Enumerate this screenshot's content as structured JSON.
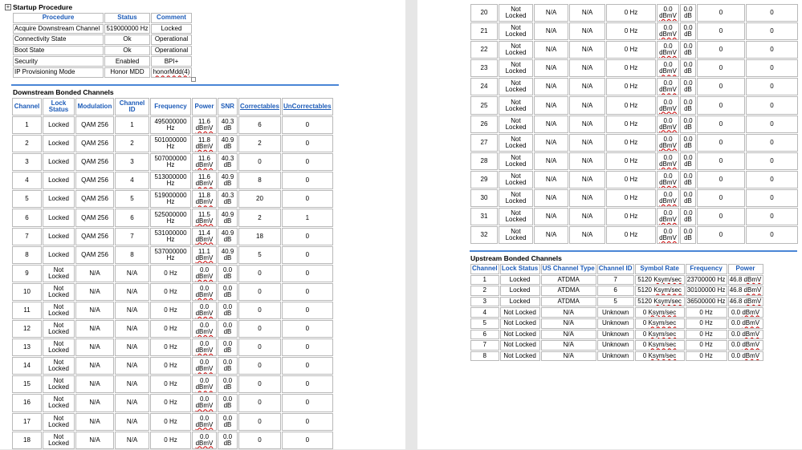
{
  "startup": {
    "toggle_glyph": "+",
    "title": "Startup Procedure",
    "headers": [
      "Procedure",
      "Status",
      "Comment"
    ],
    "rows": [
      {
        "procedure": "Acquire Downstream Channel",
        "status": "519000000 Hz",
        "comment": "Locked"
      },
      {
        "procedure": "Connectivity State",
        "status": "Ok",
        "comment": "Operational"
      },
      {
        "procedure": "Boot State",
        "status": "Ok",
        "comment": "Operational"
      },
      {
        "procedure": "Security",
        "status": "Enabled",
        "comment": "BPI+"
      },
      {
        "procedure": "IP Provisioning Mode",
        "status": "Honor MDD",
        "comment": "honorMdd(4)"
      }
    ]
  },
  "downstream": {
    "title": "Downstream Bonded Channels",
    "headers": [
      "Channel",
      "Lock Status",
      "Modulation",
      "Channel ID",
      "Frequency",
      "Power",
      "SNR",
      "Correctables",
      "UnCorrectables"
    ],
    "rows": [
      {
        "channel": "1",
        "lock": "Locked",
        "mod": "QAM 256",
        "id": "1",
        "freq": "495000000 Hz",
        "power": "11.6",
        "unit": "dBmV",
        "snr": "40.3 dB",
        "corr": "6",
        "uncorr": "0"
      },
      {
        "channel": "2",
        "lock": "Locked",
        "mod": "QAM 256",
        "id": "2",
        "freq": "501000000 Hz",
        "power": "11.8",
        "unit": "dBmV",
        "snr": "40.9 dB",
        "corr": "2",
        "uncorr": "0"
      },
      {
        "channel": "3",
        "lock": "Locked",
        "mod": "QAM 256",
        "id": "3",
        "freq": "507000000 Hz",
        "power": "11.6",
        "unit": "dBmV",
        "snr": "40.3 dB",
        "corr": "0",
        "uncorr": "0"
      },
      {
        "channel": "4",
        "lock": "Locked",
        "mod": "QAM 256",
        "id": "4",
        "freq": "513000000 Hz",
        "power": "11.6",
        "unit": "dBmV",
        "snr": "40.9 dB",
        "corr": "8",
        "uncorr": "0"
      },
      {
        "channel": "5",
        "lock": "Locked",
        "mod": "QAM 256",
        "id": "5",
        "freq": "519000000 Hz",
        "power": "11.8",
        "unit": "dBmV",
        "snr": "40.3 dB",
        "corr": "20",
        "uncorr": "0"
      },
      {
        "channel": "6",
        "lock": "Locked",
        "mod": "QAM 256",
        "id": "6",
        "freq": "525000000 Hz",
        "power": "11.5",
        "unit": "dBmV",
        "snr": "40.9 dB",
        "corr": "2",
        "uncorr": "1"
      },
      {
        "channel": "7",
        "lock": "Locked",
        "mod": "QAM 256",
        "id": "7",
        "freq": "531000000 Hz",
        "power": "11.4",
        "unit": "dBmV",
        "snr": "40.9 dB",
        "corr": "18",
        "uncorr": "0"
      },
      {
        "channel": "8",
        "lock": "Locked",
        "mod": "QAM 256",
        "id": "8",
        "freq": "537000000 Hz",
        "power": "11.1",
        "unit": "dBmV",
        "snr": "40.9 dB",
        "corr": "5",
        "uncorr": "0"
      },
      {
        "channel": "9",
        "lock": "Not Locked",
        "mod": "N/A",
        "id": "N/A",
        "freq": "0 Hz",
        "power": "0.0",
        "unit": "dBmV",
        "snr": "0.0 dB",
        "corr": "0",
        "uncorr": "0"
      },
      {
        "channel": "10",
        "lock": "Not Locked",
        "mod": "N/A",
        "id": "N/A",
        "freq": "0 Hz",
        "power": "0.0",
        "unit": "dBmV",
        "snr": "0.0 dB",
        "corr": "0",
        "uncorr": "0"
      },
      {
        "channel": "11",
        "lock": "Not Locked",
        "mod": "N/A",
        "id": "N/A",
        "freq": "0 Hz",
        "power": "0.0",
        "unit": "dBmV",
        "snr": "0.0 dB",
        "corr": "0",
        "uncorr": "0"
      },
      {
        "channel": "12",
        "lock": "Not Locked",
        "mod": "N/A",
        "id": "N/A",
        "freq": "0 Hz",
        "power": "0.0",
        "unit": "dBmV",
        "snr": "0.0 dB",
        "corr": "0",
        "uncorr": "0"
      },
      {
        "channel": "13",
        "lock": "Not Locked",
        "mod": "N/A",
        "id": "N/A",
        "freq": "0 Hz",
        "power": "0.0",
        "unit": "dBmV",
        "snr": "0.0 dB",
        "corr": "0",
        "uncorr": "0"
      },
      {
        "channel": "14",
        "lock": "Not Locked",
        "mod": "N/A",
        "id": "N/A",
        "freq": "0 Hz",
        "power": "0.0",
        "unit": "dBmV",
        "snr": "0.0 dB",
        "corr": "0",
        "uncorr": "0"
      },
      {
        "channel": "15",
        "lock": "Not Locked",
        "mod": "N/A",
        "id": "N/A",
        "freq": "0 Hz",
        "power": "0.0",
        "unit": "dBmV",
        "snr": "0.0 dB",
        "corr": "0",
        "uncorr": "0"
      },
      {
        "channel": "16",
        "lock": "Not Locked",
        "mod": "N/A",
        "id": "N/A",
        "freq": "0 Hz",
        "power": "0.0",
        "unit": "dBmV",
        "snr": "0.0 dB",
        "corr": "0",
        "uncorr": "0"
      },
      {
        "channel": "17",
        "lock": "Not Locked",
        "mod": "N/A",
        "id": "N/A",
        "freq": "0 Hz",
        "power": "0.0",
        "unit": "dBmV",
        "snr": "0.0 dB",
        "corr": "0",
        "uncorr": "0"
      },
      {
        "channel": "18",
        "lock": "Not Locked",
        "mod": "N/A",
        "id": "N/A",
        "freq": "0 Hz",
        "power": "0.0",
        "unit": "dBmV",
        "snr": "0.0 dB",
        "corr": "0",
        "uncorr": "0"
      }
    ],
    "rows_continued": [
      {
        "channel": "20",
        "lock": "Not Locked",
        "mod": "N/A",
        "id": "N/A",
        "freq": "0 Hz",
        "power": "0.0",
        "unit": "dBmV",
        "snr": "0.0 dB",
        "corr": "0",
        "uncorr": "0"
      },
      {
        "channel": "21",
        "lock": "Not Locked",
        "mod": "N/A",
        "id": "N/A",
        "freq": "0 Hz",
        "power": "0.0",
        "unit": "dBmV",
        "snr": "0.0 dB",
        "corr": "0",
        "uncorr": "0"
      },
      {
        "channel": "22",
        "lock": "Not Locked",
        "mod": "N/A",
        "id": "N/A",
        "freq": "0 Hz",
        "power": "0.0",
        "unit": "dBmV",
        "snr": "0.0 dB",
        "corr": "0",
        "uncorr": "0"
      },
      {
        "channel": "23",
        "lock": "Not Locked",
        "mod": "N/A",
        "id": "N/A",
        "freq": "0 Hz",
        "power": "0.0",
        "unit": "dBmV",
        "snr": "0.0 dB",
        "corr": "0",
        "uncorr": "0"
      },
      {
        "channel": "24",
        "lock": "Not Locked",
        "mod": "N/A",
        "id": "N/A",
        "freq": "0 Hz",
        "power": "0.0",
        "unit": "dBmV",
        "snr": "0.0 dB",
        "corr": "0",
        "uncorr": "0"
      },
      {
        "channel": "25",
        "lock": "Not Locked",
        "mod": "N/A",
        "id": "N/A",
        "freq": "0 Hz",
        "power": "0.0",
        "unit": "dBmV",
        "snr": "0.0 dB",
        "corr": "0",
        "uncorr": "0"
      },
      {
        "channel": "26",
        "lock": "Not Locked",
        "mod": "N/A",
        "id": "N/A",
        "freq": "0 Hz",
        "power": "0.0",
        "unit": "dBmV",
        "snr": "0.0 dB",
        "corr": "0",
        "uncorr": "0"
      },
      {
        "channel": "27",
        "lock": "Not Locked",
        "mod": "N/A",
        "id": "N/A",
        "freq": "0 Hz",
        "power": "0.0",
        "unit": "dBmV",
        "snr": "0.0 dB",
        "corr": "0",
        "uncorr": "0"
      },
      {
        "channel": "28",
        "lock": "Not Locked",
        "mod": "N/A",
        "id": "N/A",
        "freq": "0 Hz",
        "power": "0.0",
        "unit": "dBmV",
        "snr": "0.0 dB",
        "corr": "0",
        "uncorr": "0"
      },
      {
        "channel": "29",
        "lock": "Not Locked",
        "mod": "N/A",
        "id": "N/A",
        "freq": "0 Hz",
        "power": "0.0",
        "unit": "dBmV",
        "snr": "0.0 dB",
        "corr": "0",
        "uncorr": "0"
      },
      {
        "channel": "30",
        "lock": "Not Locked",
        "mod": "N/A",
        "id": "N/A",
        "freq": "0 Hz",
        "power": "0.0",
        "unit": "dBmV",
        "snr": "0.0 dB",
        "corr": "0",
        "uncorr": "0"
      },
      {
        "channel": "31",
        "lock": "Not Locked",
        "mod": "N/A",
        "id": "N/A",
        "freq": "0 Hz",
        "power": "0.0",
        "unit": "dBmV",
        "snr": "0.0 dB",
        "corr": "0",
        "uncorr": "0"
      },
      {
        "channel": "32",
        "lock": "Not Locked",
        "mod": "N/A",
        "id": "N/A",
        "freq": "0 Hz",
        "power": "0.0",
        "unit": "dBmV",
        "snr": "0.0 dB",
        "corr": "0",
        "uncorr": "0"
      }
    ]
  },
  "upstream": {
    "title": "Upstream Bonded Channels",
    "headers": [
      "Channel",
      "Lock Status",
      "US Channel Type",
      "Channel ID",
      "Symbol Rate",
      "Frequency",
      "Power"
    ],
    "rows": [
      {
        "channel": "1",
        "lock": "Locked",
        "type": "ATDMA",
        "id": "7",
        "rate": "5120",
        "rate_unit": "Ksym/sec",
        "freq": "23700000 Hz",
        "power": "46.8",
        "unit": "dBmV"
      },
      {
        "channel": "2",
        "lock": "Locked",
        "type": "ATDMA",
        "id": "6",
        "rate": "5120",
        "rate_unit": "Ksym/sec",
        "freq": "30100000 Hz",
        "power": "46.8",
        "unit": "dBmV"
      },
      {
        "channel": "3",
        "lock": "Locked",
        "type": "ATDMA",
        "id": "5",
        "rate": "5120",
        "rate_unit": "Ksym/sec",
        "freq": "36500000 Hz",
        "power": "46.8",
        "unit": "dBmV"
      },
      {
        "channel": "4",
        "lock": "Not Locked",
        "type": "N/A",
        "id": "Unknown",
        "rate": "0",
        "rate_unit": "Ksym/sec",
        "freq": "0 Hz",
        "power": "0.0",
        "unit": "dBmV"
      },
      {
        "channel": "5",
        "lock": "Not Locked",
        "type": "N/A",
        "id": "Unknown",
        "rate": "0",
        "rate_unit": "Ksym/sec",
        "freq": "0 Hz",
        "power": "0.0",
        "unit": "dBmV"
      },
      {
        "channel": "6",
        "lock": "Not Locked",
        "type": "N/A",
        "id": "Unknown",
        "rate": "0",
        "rate_unit": "Ksym/sec",
        "freq": "0 Hz",
        "power": "0.0",
        "unit": "dBmV"
      },
      {
        "channel": "7",
        "lock": "Not Locked",
        "type": "N/A",
        "id": "Unknown",
        "rate": "0",
        "rate_unit": "Ksym/sec",
        "freq": "0 Hz",
        "power": "0.0",
        "unit": "dBmV"
      },
      {
        "channel": "8",
        "lock": "Not Locked",
        "type": "N/A",
        "id": "Unknown",
        "rate": "0",
        "rate_unit": "Ksym/sec",
        "freq": "0 Hz",
        "power": "0.0",
        "unit": "dBmV"
      }
    ]
  },
  "colors": {
    "header_text": "#1c5bb8",
    "rule": "#4a86d6",
    "border": "#b9b9b9"
  }
}
